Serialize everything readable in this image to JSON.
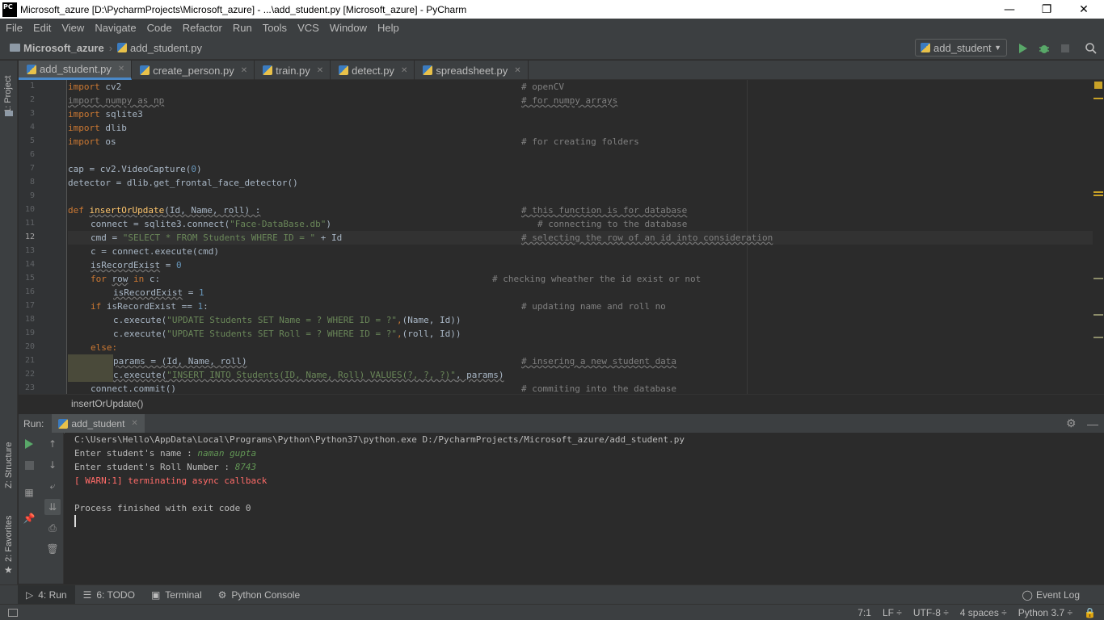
{
  "window": {
    "logo": "PC",
    "title": "Microsoft_azure [D:\\PycharmProjects\\Microsoft_azure] - ...\\add_student.py [Microsoft_azure] - PyCharm",
    "minimize": "—",
    "restore": "❐",
    "close": "✕"
  },
  "menu": [
    "File",
    "Edit",
    "View",
    "Navigate",
    "Code",
    "Refactor",
    "Run",
    "Tools",
    "VCS",
    "Window",
    "Help"
  ],
  "navbar": {
    "project": "Microsoft_azure",
    "file": "add_student.py",
    "run_config": "add_student"
  },
  "left_strip": {
    "project_label": "1: Project",
    "structure_label": "Z: Structure",
    "favorites_label": "2: Favorites"
  },
  "editor_tabs": [
    {
      "label": "add_student.py",
      "active": true
    },
    {
      "label": "create_person.py",
      "active": false
    },
    {
      "label": "train.py",
      "active": false
    },
    {
      "label": "detect.py",
      "active": false
    },
    {
      "label": "spreadsheet.py",
      "active": false
    }
  ],
  "line_numbers": [
    "1",
    "2",
    "3",
    "4",
    "5",
    "6",
    "7",
    "8",
    "9",
    "10",
    "11",
    "12",
    "13",
    "14",
    "15",
    "16",
    "17",
    "18",
    "19",
    "20",
    "21",
    "22",
    "23"
  ],
  "code_lines": {
    "l1_a": "import",
    "l1_b": " cv2",
    "l1_c": "# openCV",
    "l2_a": "import numpy as np",
    "l2_c": "# for numpy arrays",
    "l3_a": "import",
    "l3_b": " sqlite3",
    "l4_a": "import",
    "l4_b": " dlib",
    "l5_a": "import",
    "l5_b": " os",
    "l5_c": "# for creating folders",
    "l7": "cap = cv2.VideoCapture(",
    "l7_num": "0",
    "l7_end": ")",
    "l8": "detector = dlib.get_frontal_face_detector()",
    "l10_a": "def",
    "l10_b": "insertOrUpdate",
    "l10_c": "(Id, Name, roll) :",
    "l10_d": "# this function is for database",
    "l11_a": "connect = sqlite3.connect(",
    "l11_b": "\"Face-DataBase.db\"",
    "l11_c": ")",
    "l11_d": "# connecting to the database",
    "l12_a": "cmd = ",
    "l12_b": "\"SELECT * FROM Students WHERE ID = \"",
    "l12_c": " + Id",
    "l12_d": "# selecting the row of an id into consideration",
    "l13": "c = connect.execute(cmd)",
    "l14_a": "isRecordExist",
    "l14_b": " = ",
    "l14_c": "0",
    "l15_a": "for",
    "l15_b": "row",
    "l15_c": "in",
    "l15_d": " c:",
    "l15_e": "# checking wheather the id exist or not",
    "l16_a": "isRecordExist",
    "l16_b": " = ",
    "l16_c": "1",
    "l17_a": "if",
    "l17_b": " isRecordExist == ",
    "l17_c": "1",
    "l17_d": ":",
    "l17_e": "# updating name and roll no",
    "l18_a": "c.execute(",
    "l18_b": "\"UPDATE Students SET Name = ? WHERE ID = ?\"",
    "l18_c": ",",
    "l18_d": "(Name, Id))",
    "l19_a": "c.execute(",
    "l19_b": "\"UPDATE Students SET Roll = ? WHERE ID = ?\"",
    "l19_c": ",",
    "l19_d": "(roll, Id))",
    "l20": "else:",
    "l21_a": "params = (Id, Name, roll)",
    "l21_b": "# insering a new student data",
    "l22_a": "c.execute(",
    "l22_b": "\"INSERT INTO Students(ID, Name, Roll) VALUES(?, ?, ?)\"",
    "l22_c": ", params)",
    "l23_a": "connect.commit()",
    "l23_b": "# commiting into the database"
  },
  "breadcrumb": "insertOrUpdate()",
  "run_panel": {
    "label": "Run:",
    "tab": "add_student"
  },
  "console": {
    "cmd": "C:\\Users\\Hello\\AppData\\Local\\Programs\\Python\\Python37\\python.exe D:/PycharmProjects/Microsoft_azure/add_student.py",
    "prompt_name": "Enter student's name : ",
    "input_name": "naman gupta",
    "prompt_roll": "Enter student's Roll Number : ",
    "input_roll": "8743",
    "warn": "[ WARN:1] terminating async callback",
    "exit": "Process finished with exit code 0"
  },
  "bottom_tabs": {
    "run": "4: Run",
    "todo": "6: TODO",
    "terminal": "Terminal",
    "python_console": "Python Console",
    "event_log": "Event Log"
  },
  "status": {
    "position": "7:1",
    "line_sep": "LF ÷",
    "encoding": "UTF-8 ÷",
    "indent": "4 spaces ÷",
    "interpreter": "Python 3.7 ÷"
  },
  "colors": {
    "accent": "#4a88c7",
    "run_green": "#59a869",
    "warn_red": "#ff6b68",
    "input_green": "#629755"
  }
}
